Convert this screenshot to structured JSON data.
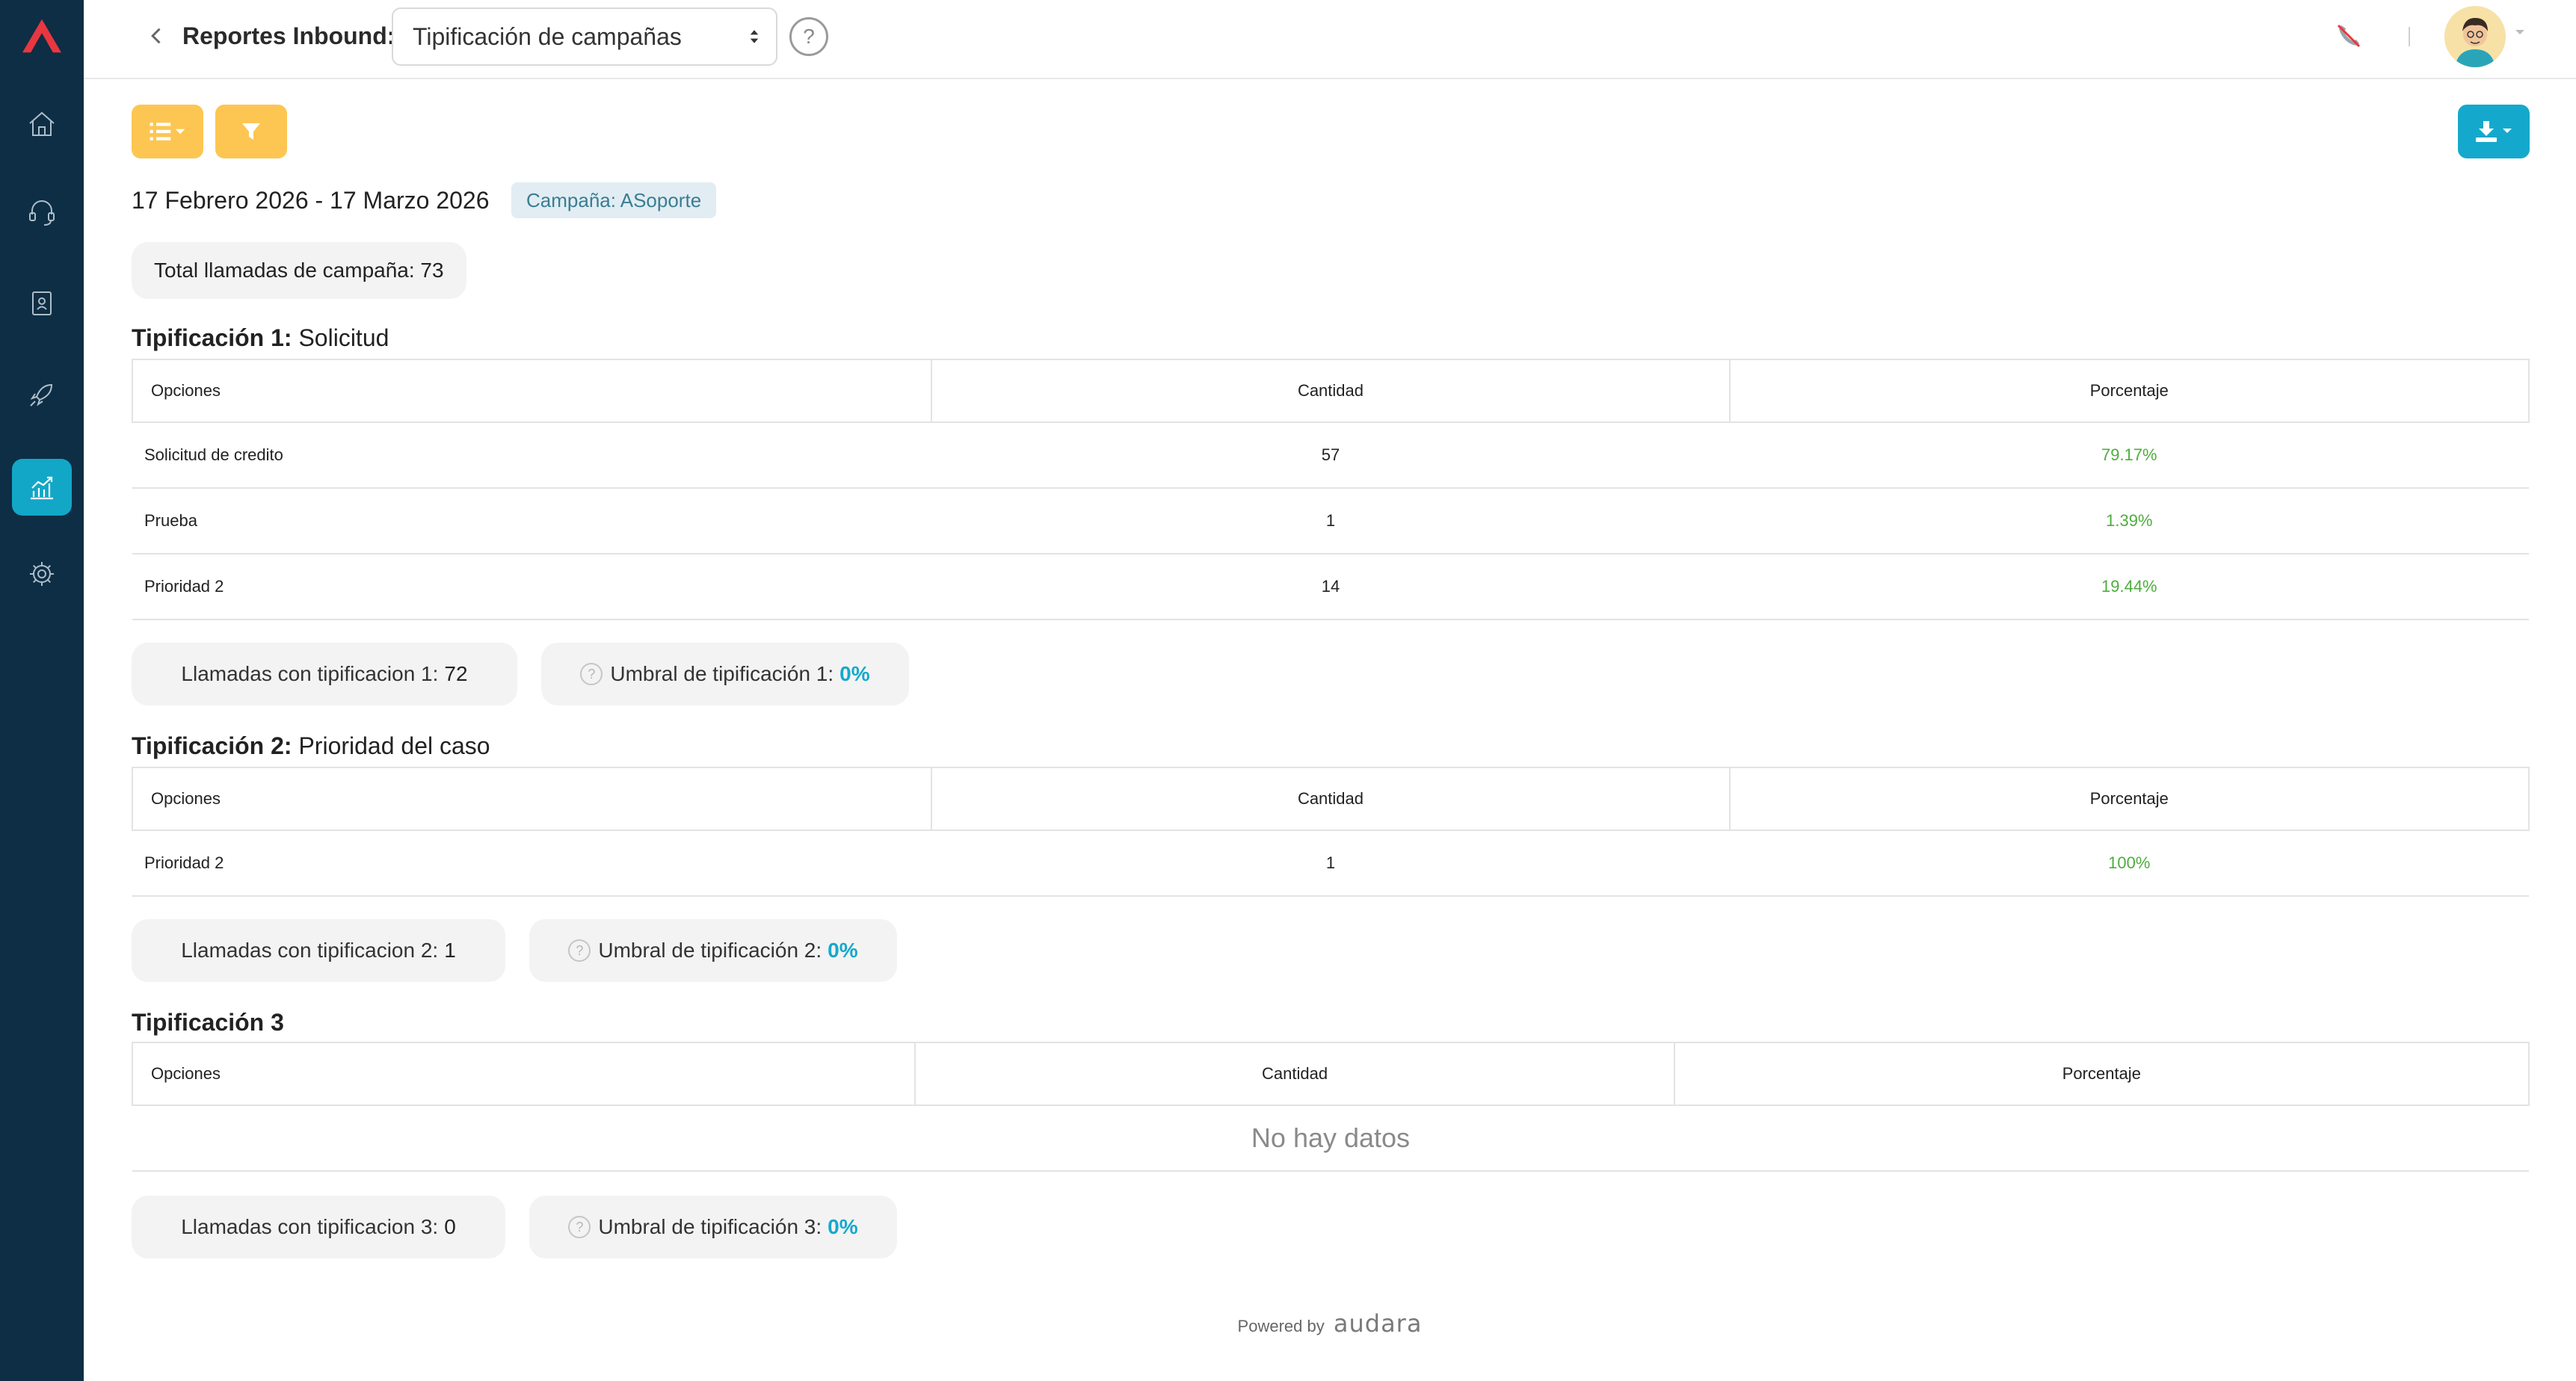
{
  "app": {
    "colors": {
      "sidebar": "#0d2e45",
      "accent": "#14a9cc",
      "yellow": "#fdc652",
      "green": "#4cae3c"
    }
  },
  "sidebar": {
    "items": [
      {
        "name": "home",
        "icon": "home-icon"
      },
      {
        "name": "agents",
        "icon": "headset-icon"
      },
      {
        "name": "contacts",
        "icon": "address-book-icon"
      },
      {
        "name": "campaigns",
        "icon": "rocket-icon"
      },
      {
        "name": "reports",
        "icon": "chart-icon",
        "active": true
      },
      {
        "name": "settings",
        "icon": "gear-icon"
      }
    ]
  },
  "header": {
    "title": "Reportes Inbound:",
    "report_select_value": "Tipificación de campañas",
    "help": "?"
  },
  "filters": {
    "date_range": "17 Febrero 2026 - 17 Marzo 2026",
    "campaign_tag": "Campaña: ASoporte",
    "total_label": "Total llamadas de campaña: 73"
  },
  "tables": {
    "headers": {
      "options": "Opciones",
      "quantity": "Cantidad",
      "percent": "Porcentaje"
    }
  },
  "t1": {
    "title_bold": "Tipificación 1:",
    "title_rest": " Solicitud",
    "rows": [
      {
        "option": "Solicitud de credito",
        "qty": "57",
        "pct": "79.17%"
      },
      {
        "option": "Prueba",
        "qty": "1",
        "pct": "1.39%"
      },
      {
        "option": "Prioridad 2",
        "qty": "14",
        "pct": "19.44%"
      }
    ],
    "calls_label": "Llamadas con tipificacion 1:",
    "calls_value": "72",
    "threshold_label": "Umbral de tipificación 1:",
    "threshold_value": "0%"
  },
  "t2": {
    "title_bold": "Tipificación 2:",
    "title_rest": " Prioridad del caso",
    "rows": [
      {
        "option": "Prioridad 2",
        "qty": "1",
        "pct": "100%"
      }
    ],
    "calls_label": "Llamadas con tipificacion 2:",
    "calls_value": "1",
    "threshold_label": "Umbral de tipificación 2:",
    "threshold_value": "0%"
  },
  "t3": {
    "title_bold": "Tipificación 3",
    "title_rest": "",
    "empty": "No hay datos",
    "calls_label": "Llamadas con tipificacion 3:",
    "calls_value": "0",
    "threshold_label": "Umbral de tipificación 3:",
    "threshold_value": "0%"
  },
  "footer": {
    "powered": "Powered by",
    "brand": "audara"
  }
}
